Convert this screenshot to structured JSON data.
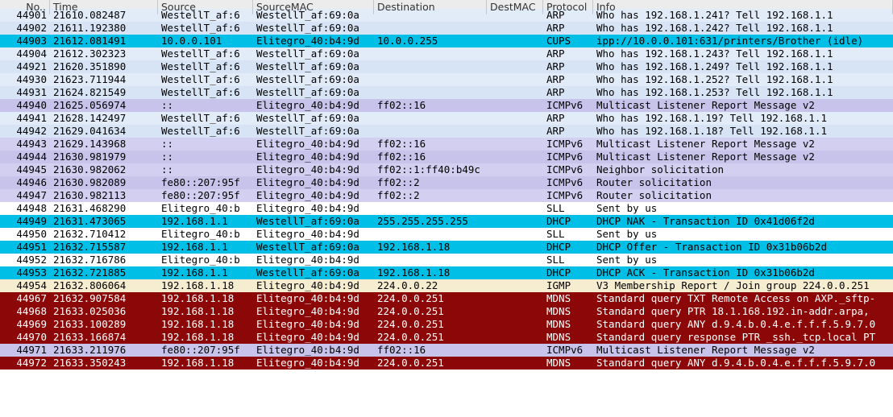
{
  "columns": {
    "no": "No..",
    "time": "Time",
    "source": "Source",
    "sourcemac": "SourceMAC",
    "destination": "Destination",
    "destmac": "DestMAC",
    "protocol": "Protocol",
    "info": "Info"
  },
  "rows": [
    {
      "no": "44901",
      "time": "21610.082487",
      "src": "WestellT_af:6",
      "smac": "WestellT_af:69:0a",
      "dst": "",
      "dmac": "",
      "proto": "ARP",
      "info": "Who has 192.168.1.241?  Tell 192.168.1.1",
      "cls": "bg-arp-alt partial-top"
    },
    {
      "no": "44902",
      "time": "21611.192380",
      "src": "WestellT_af:6",
      "smac": "WestellT_af:69:0a",
      "dst": "",
      "dmac": "",
      "proto": "ARP",
      "info": "Who has 192.168.1.242?  Tell 192.168.1.1",
      "cls": "bg-arp"
    },
    {
      "no": "44903",
      "time": "21612.081491",
      "src": "10.0.0.101",
      "smac": "Elitegro_40:b4:9d",
      "dst": "10.0.0.255",
      "dmac": "",
      "proto": "CUPS",
      "info": "ipp://10.0.0.101:631/printers/Brother (idle)",
      "cls": "bg-cups"
    },
    {
      "no": "44904",
      "time": "21612.302323",
      "src": "WestellT_af:6",
      "smac": "WestellT_af:69:0a",
      "dst": "",
      "dmac": "",
      "proto": "ARP",
      "info": "Who has 192.168.1.243?  Tell 192.168.1.1",
      "cls": "bg-arp-alt"
    },
    {
      "no": "44921",
      "time": "21620.351890",
      "src": "WestellT_af:6",
      "smac": "WestellT_af:69:0a",
      "dst": "",
      "dmac": "",
      "proto": "ARP",
      "info": "Who has 192.168.1.249?  Tell 192.168.1.1",
      "cls": "bg-arp"
    },
    {
      "no": "44930",
      "time": "21623.711944",
      "src": "WestellT_af:6",
      "smac": "WestellT_af:69:0a",
      "dst": "",
      "dmac": "",
      "proto": "ARP",
      "info": "Who has 192.168.1.252?  Tell 192.168.1.1",
      "cls": "bg-arp-alt"
    },
    {
      "no": "44931",
      "time": "21624.821549",
      "src": "WestellT_af:6",
      "smac": "WestellT_af:69:0a",
      "dst": "",
      "dmac": "",
      "proto": "ARP",
      "info": "Who has 192.168.1.253?  Tell 192.168.1.1",
      "cls": "bg-arp"
    },
    {
      "no": "44940",
      "time": "21625.056974",
      "src": "::",
      "smac": "Elitegro_40:b4:9d",
      "dst": "ff02::16",
      "dmac": "",
      "proto": "ICMPv6",
      "info": "Multicast Listener Report Message v2",
      "cls": "bg-icmpv6"
    },
    {
      "no": "44941",
      "time": "21628.142497",
      "src": "WestellT_af:6",
      "smac": "WestellT_af:69:0a",
      "dst": "",
      "dmac": "",
      "proto": "ARP",
      "info": "Who has 192.168.1.19?  Tell 192.168.1.1",
      "cls": "bg-arp-alt"
    },
    {
      "no": "44942",
      "time": "21629.041634",
      "src": "WestellT_af:6",
      "smac": "WestellT_af:69:0a",
      "dst": "",
      "dmac": "",
      "proto": "ARP",
      "info": "Who has 192.168.1.18?  Tell 192.168.1.1",
      "cls": "bg-arp"
    },
    {
      "no": "44943",
      "time": "21629.143968",
      "src": "::",
      "smac": "Elitegro_40:b4:9d",
      "dst": "ff02::16",
      "dmac": "",
      "proto": "ICMPv6",
      "info": "Multicast Listener Report Message v2",
      "cls": "bg-icmpv6-alt"
    },
    {
      "no": "44944",
      "time": "21630.981979",
      "src": "::",
      "smac": "Elitegro_40:b4:9d",
      "dst": "ff02::16",
      "dmac": "",
      "proto": "ICMPv6",
      "info": "Multicast Listener Report Message v2",
      "cls": "bg-icmpv6"
    },
    {
      "no": "44945",
      "time": "21630.982062",
      "src": "::",
      "smac": "Elitegro_40:b4:9d",
      "dst": "ff02::1:ff40:b49c",
      "dmac": "",
      "proto": "ICMPv6",
      "info": "Neighbor solicitation",
      "cls": "bg-icmpv6-alt"
    },
    {
      "no": "44946",
      "time": "21630.982089",
      "src": "fe80::207:95f",
      "smac": "Elitegro_40:b4:9d",
      "dst": "ff02::2",
      "dmac": "",
      "proto": "ICMPv6",
      "info": "Router solicitation",
      "cls": "bg-icmpv6"
    },
    {
      "no": "44947",
      "time": "21630.982113",
      "src": "fe80::207:95f",
      "smac": "Elitegro_40:b4:9d",
      "dst": "ff02::2",
      "dmac": "",
      "proto": "ICMPv6",
      "info": "Router solicitation",
      "cls": "bg-icmpv6-alt"
    },
    {
      "no": "44948",
      "time": "21631.468290",
      "src": "Elitegro_40:b",
      "smac": "Elitegro_40:b4:9d",
      "dst": "",
      "dmac": "",
      "proto": "SLL",
      "info": "Sent by us",
      "cls": "bg-sll"
    },
    {
      "no": "44949",
      "time": "21631.473065",
      "src": "192.168.1.1",
      "smac": "WestellT_af:69:0a",
      "dst": "255.255.255.255",
      "dmac": "",
      "proto": "DHCP",
      "info": "DHCP NAK      - Transaction ID 0x41d06f2d",
      "cls": "bg-dhcp"
    },
    {
      "no": "44950",
      "time": "21632.710412",
      "src": "Elitegro_40:b",
      "smac": "Elitegro_40:b4:9d",
      "dst": "",
      "dmac": "",
      "proto": "SLL",
      "info": "Sent by us",
      "cls": "bg-sll"
    },
    {
      "no": "44951",
      "time": "21632.715587",
      "src": "192.168.1.1",
      "smac": "WestellT_af:69:0a",
      "dst": "192.168.1.18",
      "dmac": "",
      "proto": "DHCP",
      "info": "DHCP Offer    - Transaction ID 0x31b06b2d",
      "cls": "bg-dhcp"
    },
    {
      "no": "44952",
      "time": "21632.716786",
      "src": "Elitegro_40:b",
      "smac": "Elitegro_40:b4:9d",
      "dst": "",
      "dmac": "",
      "proto": "SLL",
      "info": "Sent by us",
      "cls": "bg-sll"
    },
    {
      "no": "44953",
      "time": "21632.721885",
      "src": "192.168.1.1",
      "smac": "WestellT_af:69:0a",
      "dst": "192.168.1.18",
      "dmac": "",
      "proto": "DHCP",
      "info": "DHCP ACK      - Transaction ID 0x31b06b2d",
      "cls": "bg-dhcp"
    },
    {
      "no": "44954",
      "time": "21632.806064",
      "src": "192.168.1.18",
      "smac": "Elitegro_40:b4:9d",
      "dst": "224.0.0.22",
      "dmac": "",
      "proto": "IGMP",
      "info": "V3 Membership Report / Join group 224.0.0.251",
      "cls": "bg-igmp"
    },
    {
      "no": "44967",
      "time": "21632.907584",
      "src": "192.168.1.18",
      "smac": "Elitegro_40:b4:9d",
      "dst": "224.0.0.251",
      "dmac": "",
      "proto": "MDNS",
      "info": "Standard query TXT Remote Access on AXP._sftp-",
      "cls": "bg-mdns"
    },
    {
      "no": "44968",
      "time": "21633.025036",
      "src": "192.168.1.18",
      "smac": "Elitegro_40:b4:9d",
      "dst": "224.0.0.251",
      "dmac": "",
      "proto": "MDNS",
      "info": "Standard query PTR 18.1.168.192.in-addr.arpa,",
      "cls": "bg-mdns"
    },
    {
      "no": "44969",
      "time": "21633.100289",
      "src": "192.168.1.18",
      "smac": "Elitegro_40:b4:9d",
      "dst": "224.0.0.251",
      "dmac": "",
      "proto": "MDNS",
      "info": "Standard query ANY d.9.4.b.0.4.e.f.f.f.5.9.7.0",
      "cls": "bg-mdns"
    },
    {
      "no": "44970",
      "time": "21633.166874",
      "src": "192.168.1.18",
      "smac": "Elitegro_40:b4:9d",
      "dst": "224.0.0.251",
      "dmac": "",
      "proto": "MDNS",
      "info": "Standard query response PTR _ssh._tcp.local PT",
      "cls": "bg-mdns"
    },
    {
      "no": "44971",
      "time": "21633.211976",
      "src": "fe80::207:95f",
      "smac": "Elitegro_40:b4:9d",
      "dst": "ff02::16",
      "dmac": "",
      "proto": "ICMPv6",
      "info": "Multicast Listener Report Message v2",
      "cls": "bg-icmpv6"
    },
    {
      "no": "44972",
      "time": "21633.350243",
      "src": "192.168.1.18",
      "smac": "Elitegro_40:b4:9d",
      "dst": "224.0.0.251",
      "dmac": "",
      "proto": "MDNS",
      "info": "Standard query ANY d.9.4.b.0.4.e.f.f.f.5.9.7.0",
      "cls": "bg-mdns"
    }
  ]
}
